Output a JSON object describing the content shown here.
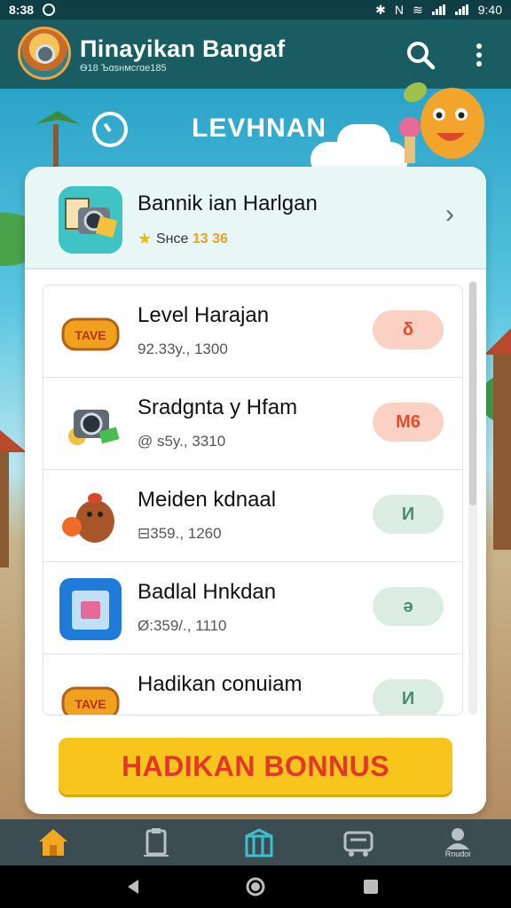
{
  "status": {
    "time": "8:38",
    "battery": "9:40"
  },
  "header": {
    "title": "Πinayikan Bangaf",
    "subtitle": "Ѳ18 Ъɑsнмсɾɑe185"
  },
  "level": {
    "label": "LEVHNAN"
  },
  "featured": {
    "title": "Bannik ian Harlgan",
    "meta_label": "Sнce",
    "meta_value": "13 36"
  },
  "items": [
    {
      "name": "Level Harajan",
      "meta": "92.33y., 1300",
      "pill": "δ",
      "pill_style": "red"
    },
    {
      "name": "Sradgnta y Hfam",
      "meta": "@ s5y., 3310",
      "pill": "M6",
      "pill_style": "red"
    },
    {
      "name": "Meiden kdnaal",
      "meta": "⊟359., 1260",
      "pill": "И",
      "pill_style": "green"
    },
    {
      "name": "Badlal Hnkdan",
      "meta": "Ø:359/., 1110",
      "pill": "ə",
      "pill_style": "green"
    },
    {
      "name": "Hadikan conuiam",
      "meta": "",
      "pill": "И",
      "pill_style": "green"
    }
  ],
  "bonus_button": "HADIKAN BONNUS",
  "nav": [
    {
      "name": "home",
      "label": ""
    },
    {
      "name": "tasks",
      "label": ""
    },
    {
      "name": "gifts",
      "label": ""
    },
    {
      "name": "shop",
      "label": ""
    },
    {
      "name": "profile",
      "label": "Rnudoi"
    }
  ],
  "colors": {
    "header": "#195d63",
    "accent": "#f8c51c",
    "bonus_text": "#e4362a"
  }
}
